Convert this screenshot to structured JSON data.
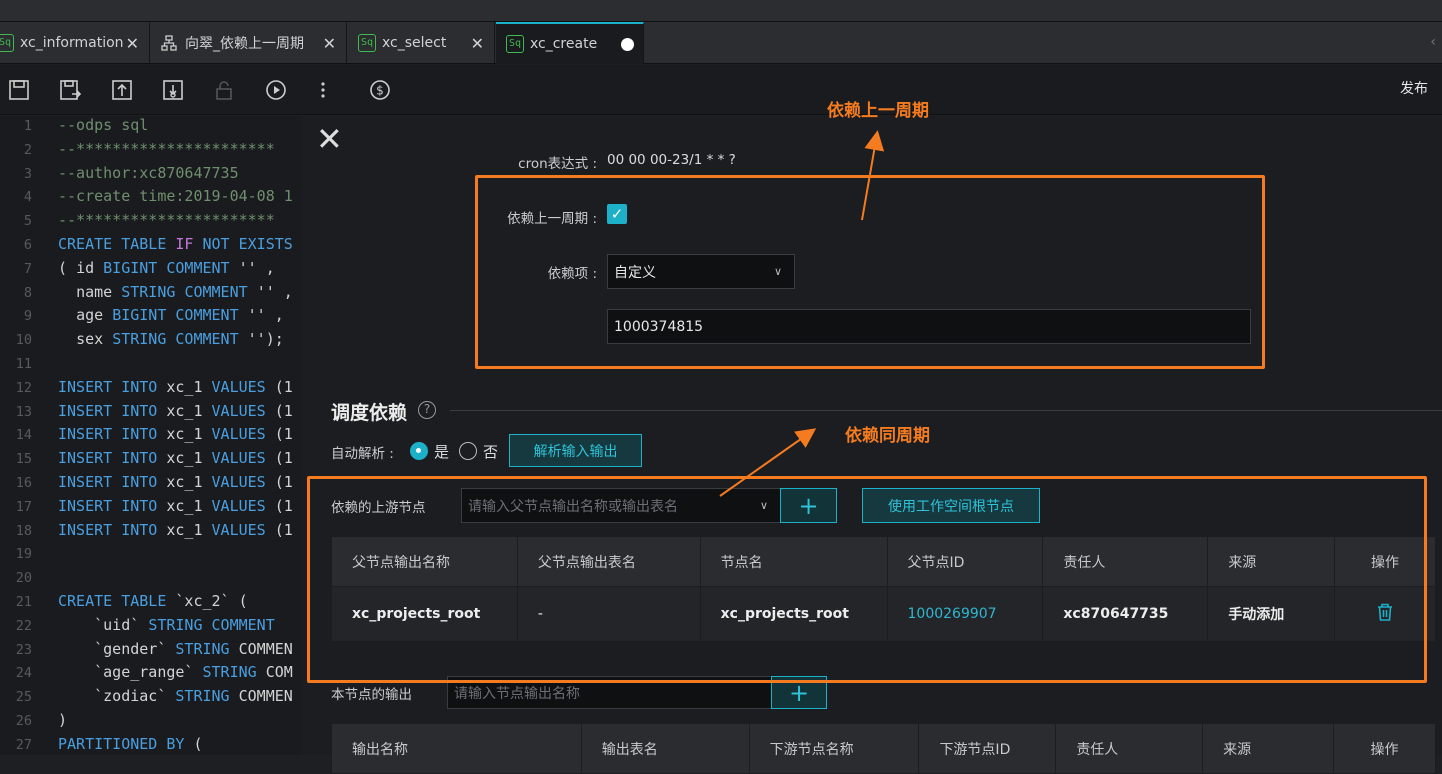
{
  "tabs": [
    {
      "label": "xc_information",
      "icon": "sq-icon"
    },
    {
      "label": "向翠_依赖上一周期",
      "icon": "flow-icon"
    },
    {
      "label": "xc_select",
      "icon": "sq-icon"
    },
    {
      "label": "xc_create",
      "icon": "sq-icon",
      "active": true
    }
  ],
  "toolbar": {
    "publish_label": "发布"
  },
  "editor": {
    "lines": [
      {
        "n": "1",
        "text": "--odps sql"
      },
      {
        "n": "2",
        "text": "--**********************"
      },
      {
        "n": "3",
        "text": "--author:xc870647735"
      },
      {
        "n": "4",
        "text": "--create time:2019-04-08 1"
      },
      {
        "n": "5",
        "text": "--**********************"
      },
      {
        "n": "6",
        "text": "CREATE TABLE IF NOT EXISTS"
      },
      {
        "n": "7",
        "text": "( id BIGINT COMMENT '' ,"
      },
      {
        "n": "8",
        "text": "  name STRING COMMENT '' ,"
      },
      {
        "n": "9",
        "text": "  age BIGINT COMMENT '' ,"
      },
      {
        "n": "10",
        "text": "  sex STRING COMMENT '');"
      },
      {
        "n": "11",
        "text": ""
      },
      {
        "n": "12",
        "text": "INSERT INTO xc_1 VALUES (1"
      },
      {
        "n": "13",
        "text": "INSERT INTO xc_1 VALUES (1"
      },
      {
        "n": "14",
        "text": "INSERT INTO xc_1 VALUES (1"
      },
      {
        "n": "15",
        "text": "INSERT INTO xc_1 VALUES (1"
      },
      {
        "n": "16",
        "text": "INSERT INTO xc_1 VALUES (1"
      },
      {
        "n": "17",
        "text": "INSERT INTO xc_1 VALUES (1"
      },
      {
        "n": "18",
        "text": "INSERT INTO xc_1 VALUES (1"
      },
      {
        "n": "19",
        "text": ""
      },
      {
        "n": "20",
        "text": ""
      },
      {
        "n": "21",
        "text": "CREATE TABLE `xc_2` ("
      },
      {
        "n": "22",
        "text": "    `uid` STRING COMMENT"
      },
      {
        "n": "23",
        "text": "    `gender` STRING COMMEN"
      },
      {
        "n": "24",
        "text": "    `age_range` STRING COM"
      },
      {
        "n": "25",
        "text": "    `zodiac` STRING COMMEN"
      },
      {
        "n": "26",
        "text": ")"
      },
      {
        "n": "27",
        "text": "PARTITIONED BY ("
      }
    ]
  },
  "panel": {
    "cron_label": "cron表达式 :",
    "cron_value": "00 00 00-23/1 * * ?",
    "depend_prev_label": "依赖上一周期 :",
    "depend_prev_checked": true,
    "depend_item_label": "依赖项 :",
    "depend_item_value": "自定义",
    "custom_node_id": "1000374815",
    "section_title": "调度依赖",
    "auto_parse_label": "自动解析 :",
    "radio_yes": "是",
    "radio_no": "否",
    "parse_button": "解析输入输出",
    "upstream_label": "依赖的上游节点",
    "upstream_placeholder": "请输入父节点输出名称或输出表名",
    "use_root_button": "使用工作空间根节点",
    "upstream_table": {
      "headers": [
        "父节点输出名称",
        "父节点输出表名",
        "节点名",
        "父节点ID",
        "责任人",
        "来源",
        "操作"
      ],
      "rows": [
        [
          "xc_projects_root",
          "-",
          "xc_projects_root",
          "1000269907",
          "xc870647735",
          "手动添加",
          ""
        ]
      ]
    },
    "output_label": "本节点的输出",
    "output_placeholder": "请输入节点输出名称",
    "output_table": {
      "headers": [
        "输出名称",
        "输出表名",
        "下游节点名称",
        "下游节点ID",
        "责任人",
        "来源",
        "操作"
      ]
    }
  },
  "annotations": {
    "prev_cycle": "依赖上一周期",
    "same_cycle": "依赖同周期"
  },
  "colors": {
    "accent": "#1cb0c9",
    "annotation": "#f47b20"
  }
}
